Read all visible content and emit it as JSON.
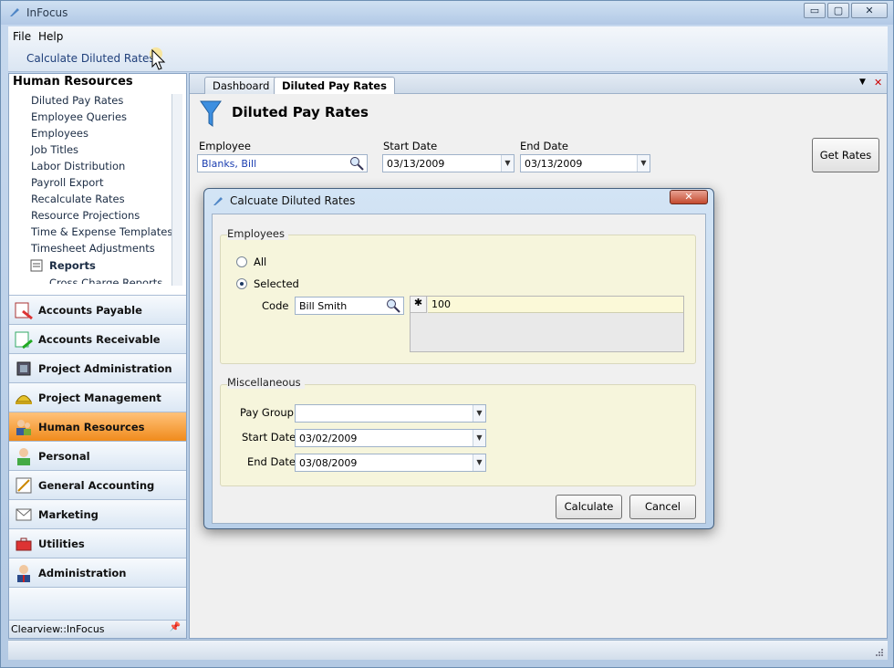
{
  "window": {
    "title": "InFocus",
    "min": "▭",
    "max": "▢",
    "close": "✕"
  },
  "menu": {
    "file": "File",
    "help": "Help",
    "calculate_button": "Calculate Diluted Rates"
  },
  "sidebar": {
    "header": "Human Resources",
    "items": [
      "Diluted Pay Rates",
      "Employee Queries",
      "Employees",
      "Job Titles",
      "Labor Distribution",
      "Payroll Export",
      "Recalculate Rates",
      "Resource Projections",
      "Time & Expense Templates",
      "Timesheet Adjustments"
    ],
    "reports_label": "Reports",
    "subitem": "Cross Charge Reports",
    "nav": [
      "Accounts Payable",
      "Accounts Receivable",
      "Project Administration",
      "Project Management",
      "Human Resources",
      "Personal",
      "General Accounting",
      "Marketing",
      "Utilities",
      "Administration"
    ],
    "footer": "Clearview::InFocus"
  },
  "tabs": {
    "dashboard": "Dashboard",
    "diluted": "Diluted Pay Rates",
    "menu_arrow": "▼",
    "close_x": "✕"
  },
  "page": {
    "title": "Diluted Pay Rates",
    "employee_label": "Employee",
    "employee_value": "Blanks, Bill",
    "start_label": "Start Date",
    "start_value": "03/13/2009",
    "end_label": "End Date",
    "end_value": "03/13/2009",
    "get_rates": "Get Rates"
  },
  "dialog": {
    "title": "Calcuate Diluted Rates",
    "close": "✕",
    "employees_group": "Employees",
    "all_label": "All",
    "selected_label": "Selected",
    "code_label": "Code",
    "code_value": "Bill Smith",
    "grid_marker": "✱",
    "grid_value": "100",
    "misc_group": "Miscellaneous",
    "paygroup_label": "Pay Group",
    "paygroup_value": "",
    "start_label": "Start Date",
    "start_value": "03/02/2009",
    "end_label": "End Date",
    "end_value": "03/08/2009",
    "calculate": "Calculate",
    "cancel": "Cancel"
  },
  "colors": {
    "accent": "#f08b1c",
    "link": "#1f3f7a",
    "group_bg": "#f6f5dc"
  }
}
